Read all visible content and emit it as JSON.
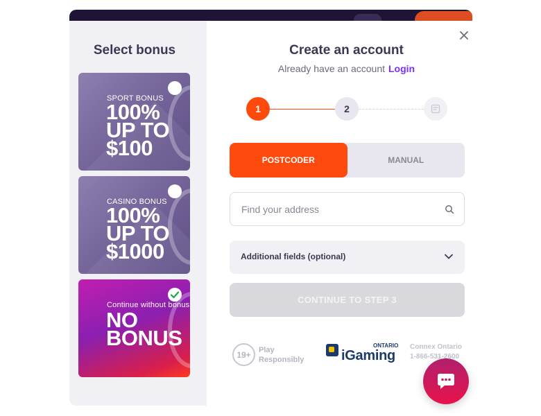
{
  "bonus_panel": {
    "title": "Select bonus",
    "cards": [
      {
        "subtitle": "SPORT BONUS",
        "headline": "100%\nUP TO\n$100",
        "selected": false,
        "color": "#7f6ea3"
      },
      {
        "subtitle": "CASINO BONUS",
        "headline": "100%\nUP TO\n$1000",
        "selected": false,
        "color": "#7f6ea3"
      },
      {
        "subtitle": "Continue without bonus",
        "headline": "NO\nBONUS",
        "selected": true,
        "color": "#b21aa6"
      }
    ]
  },
  "account": {
    "title": "Create an account",
    "login_prompt": "Already have an account",
    "login_link": "Login",
    "close_icon": "close-icon"
  },
  "steps": {
    "items": [
      "1",
      "2"
    ],
    "current": 1,
    "final_icon": "form-icon",
    "accent": "#ff4a0e"
  },
  "address_mode": {
    "options": [
      "POSTCODER",
      "MANUAL"
    ],
    "active": "POSTCODER"
  },
  "search": {
    "placeholder": "Find your address",
    "value": ""
  },
  "additional_fields": {
    "label": "Additional fields (optional)"
  },
  "continue_button": {
    "label": "CONTINUE TO STEP 3"
  },
  "footer": {
    "age_label": "19+",
    "play_text": "Play\nResponsibly",
    "igaming_brand": "iGaming",
    "igaming_region": "ONTARIO",
    "connex_text": "Connex Ontario\n1-866-531-2600"
  },
  "chat": {
    "icon": "chat-bubble-icon"
  }
}
